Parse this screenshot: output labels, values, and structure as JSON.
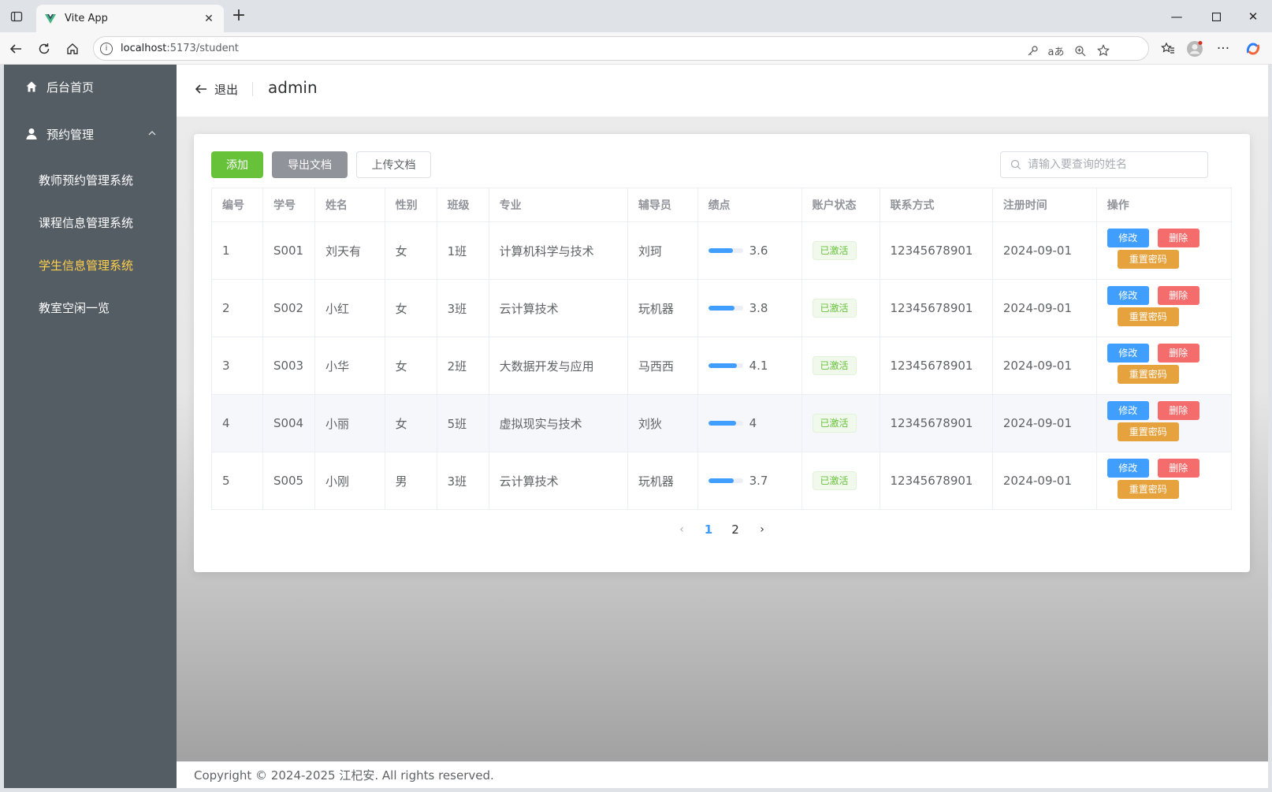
{
  "browser": {
    "tab_title": "Vite App",
    "url_host": "localhost",
    "url_path": ":5173/student"
  },
  "sidebar": {
    "home_label": "后台首页",
    "group_label": "预约管理",
    "items": [
      {
        "label": "教师预约管理系统"
      },
      {
        "label": "课程信息管理系统"
      },
      {
        "label": "学生信息管理系统"
      },
      {
        "label": "教室空闲一览"
      }
    ],
    "active_color": "#ffd04b",
    "bg_color": "#545c64"
  },
  "header": {
    "back_label": "退出",
    "title": "admin"
  },
  "toolbar": {
    "add_label": "添加",
    "export_label": "导出文档",
    "upload_label": "上传文档",
    "search_placeholder": "请输入要查询的姓名"
  },
  "table": {
    "columns": [
      "编号",
      "学号",
      "姓名",
      "性别",
      "班级",
      "专业",
      "辅导员",
      "绩点",
      "账户状态",
      "联系方式",
      "注册时间",
      "操作"
    ],
    "rows": [
      {
        "id": "1",
        "sid": "S001",
        "name": "刘天有",
        "gender": "女",
        "cls": "1班",
        "major": "计算机科学与技术",
        "advisor": "刘珂",
        "gpa": "3.6",
        "gpa_fraction": 0.72,
        "status": "已激活",
        "phone": "12345678901",
        "reg": "2024-09-01"
      },
      {
        "id": "2",
        "sid": "S002",
        "name": "小红",
        "gender": "女",
        "cls": "3班",
        "major": "云计算技术",
        "advisor": "玩机器",
        "gpa": "3.8",
        "gpa_fraction": 0.76,
        "status": "已激活",
        "phone": "12345678901",
        "reg": "2024-09-01"
      },
      {
        "id": "3",
        "sid": "S003",
        "name": "小华",
        "gender": "女",
        "cls": "2班",
        "major": "大数据开发与应用",
        "advisor": "马西西",
        "gpa": "4.1",
        "gpa_fraction": 0.82,
        "status": "已激活",
        "phone": "12345678901",
        "reg": "2024-09-01"
      },
      {
        "id": "4",
        "sid": "S004",
        "name": "小丽",
        "gender": "女",
        "cls": "5班",
        "major": "虚拟现实与技术",
        "advisor": "刘狄",
        "gpa": "4",
        "gpa_fraction": 0.8,
        "status": "已激活",
        "phone": "12345678901",
        "reg": "2024-09-01"
      },
      {
        "id": "5",
        "sid": "S005",
        "name": "小刚",
        "gender": "男",
        "cls": "3班",
        "major": "云计算技术",
        "advisor": "玩机器",
        "gpa": "3.7",
        "gpa_fraction": 0.74,
        "status": "已激活",
        "phone": "12345678901",
        "reg": "2024-09-01"
      }
    ],
    "actions": {
      "edit": "修改",
      "delete": "删除",
      "reset": "重置密码"
    }
  },
  "pagination": {
    "pages": [
      "1",
      "2"
    ],
    "current": "1"
  },
  "footer": {
    "text": "Copyright © 2024-2025 江杞安. All rights reserved."
  },
  "colors": {
    "primary": "#409eff",
    "success": "#67c23a",
    "danger": "#f56c6c",
    "warning": "#e6a23c",
    "info": "#909399"
  }
}
